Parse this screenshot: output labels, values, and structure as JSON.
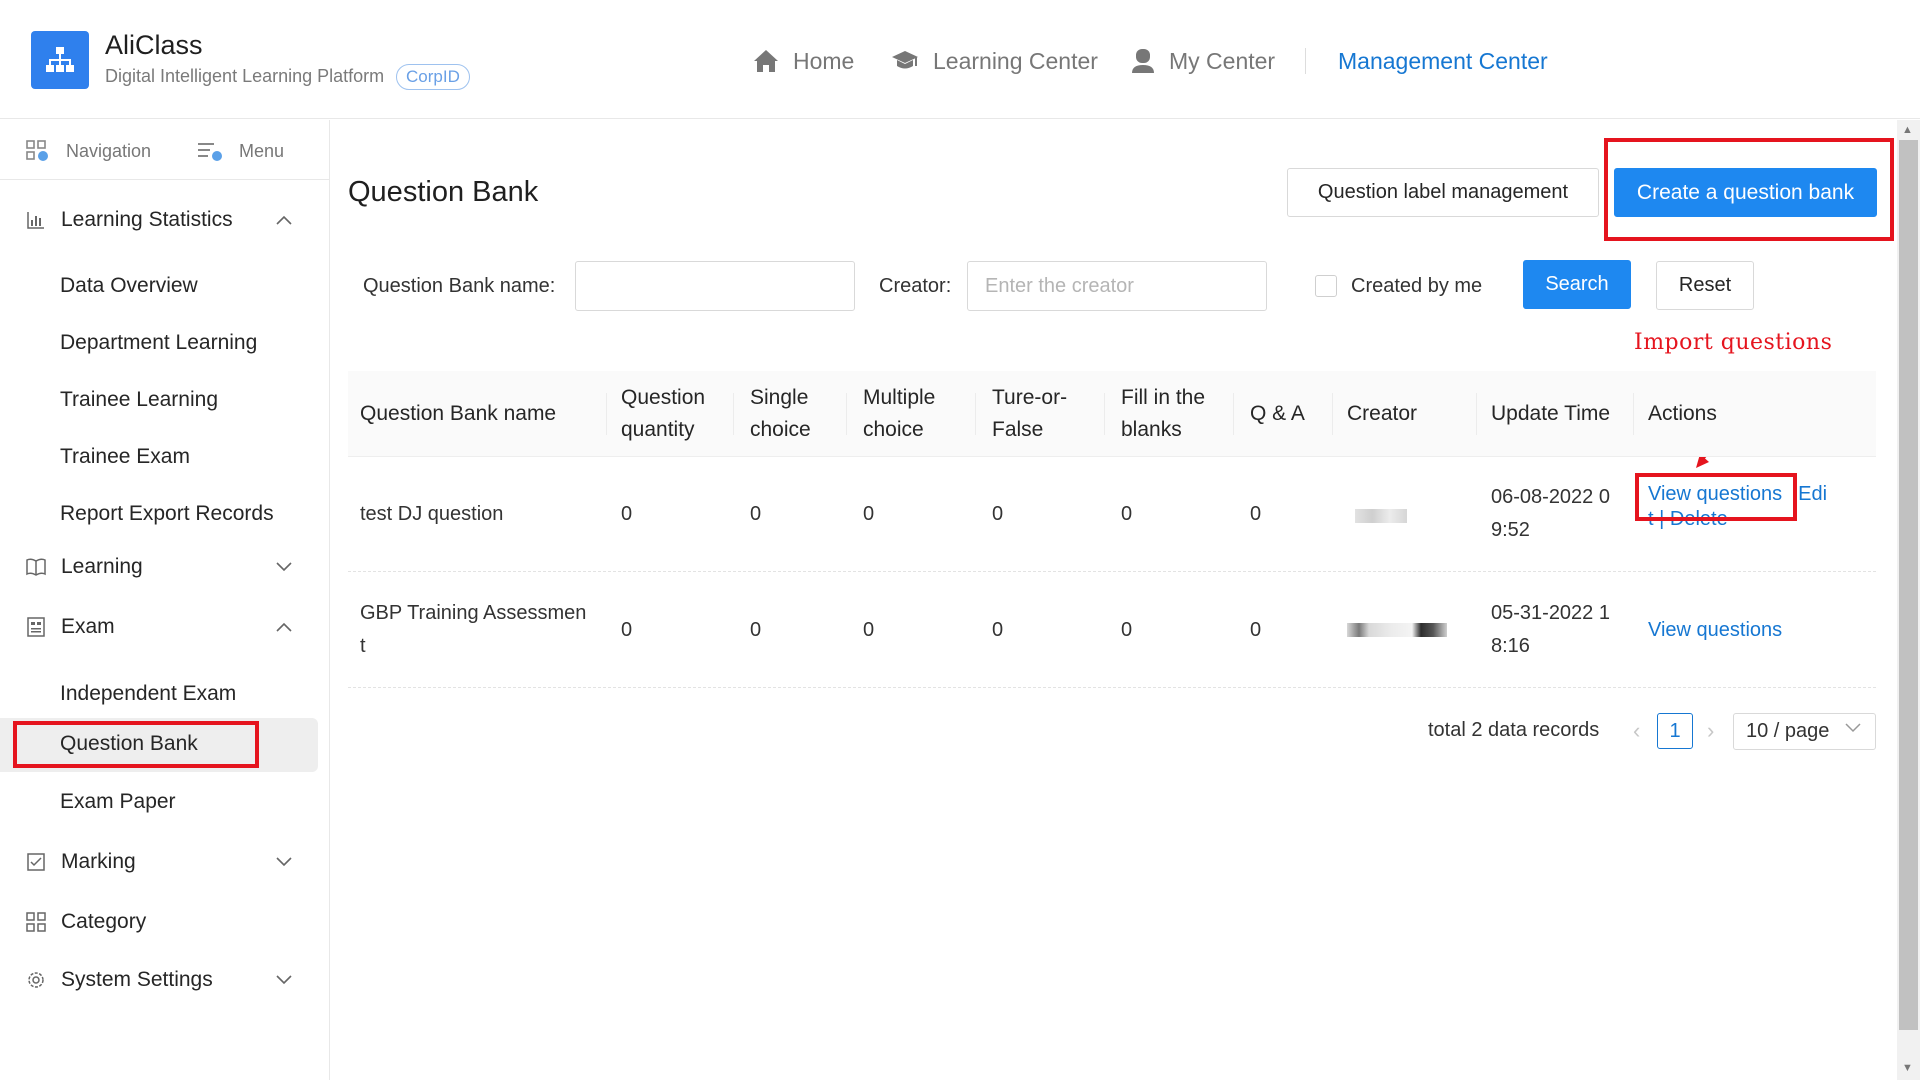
{
  "app": {
    "name": "AliClass",
    "subtitle": "Digital Intelligent Learning Platform",
    "badge": "CorpID",
    "accent_color": "#1e88f0"
  },
  "topnav": {
    "home": "Home",
    "learning_center": "Learning Center",
    "my_center": "My Center",
    "management_center": "Management Center"
  },
  "sidebar": {
    "navigation": "Navigation",
    "menu": "Menu",
    "items": [
      {
        "label": "Learning Statistics",
        "icon": "chart-icon",
        "expanded": true
      },
      {
        "label": "Data Overview"
      },
      {
        "label": "Department Learning"
      },
      {
        "label": "Trainee Learning"
      },
      {
        "label": "Trainee Exam"
      },
      {
        "label": "Report Export Records"
      },
      {
        "label": "Learning",
        "icon": "book-icon",
        "expanded": false
      },
      {
        "label": "Exam",
        "icon": "exam-icon",
        "expanded": true
      },
      {
        "label": "Independent Exam"
      },
      {
        "label": "Question Bank",
        "active": true
      },
      {
        "label": "Exam Paper"
      },
      {
        "label": "Marking",
        "icon": "marking-icon",
        "expanded": false
      },
      {
        "label": "Category",
        "icon": "category-icon"
      },
      {
        "label": "System Settings",
        "icon": "gear-icon",
        "expanded": false
      }
    ]
  },
  "main": {
    "title": "Question Bank",
    "label_mgmt_button": "Question label management",
    "create_button": "Create a question bank",
    "filters": {
      "bank_name_label": "Question Bank name",
      "bank_name_value": "",
      "creator_label": "Creator",
      "creator_placeholder": "Enter the creator",
      "created_by_me": "Created by me",
      "search": "Search",
      "reset": "Reset"
    },
    "annotation": "Import questions",
    "table": {
      "headers": [
        "Question Bank name",
        "Question quantity",
        "Single choice",
        "Multiple choice",
        "Ture-or-False",
        "Fill in the blanks",
        "Q & A",
        "Creator",
        "Update Time",
        "Actions"
      ],
      "rows": [
        {
          "name": "test DJ question",
          "quantity": "0",
          "single": "0",
          "multiple": "0",
          "tf": "0",
          "blanks": "0",
          "qa": "0",
          "update_line1": "06-08-2022 0",
          "update_line2": "9:52",
          "view": "View questions",
          "edit_a": "Edi",
          "edit_b": "t",
          "sep": " | ",
          "delete": "Delete"
        },
        {
          "name_line1": "GBP Training Assessmen",
          "name_line2": "t",
          "quantity": "0",
          "single": "0",
          "multiple": "0",
          "tf": "0",
          "blanks": "0",
          "qa": "0",
          "update_line1": "05-31-2022 1",
          "update_line2": "8:16",
          "view": "View questions"
        }
      ]
    },
    "pagination": {
      "total": "total 2 data records",
      "current_page": "1",
      "page_size": "10 / page"
    }
  }
}
